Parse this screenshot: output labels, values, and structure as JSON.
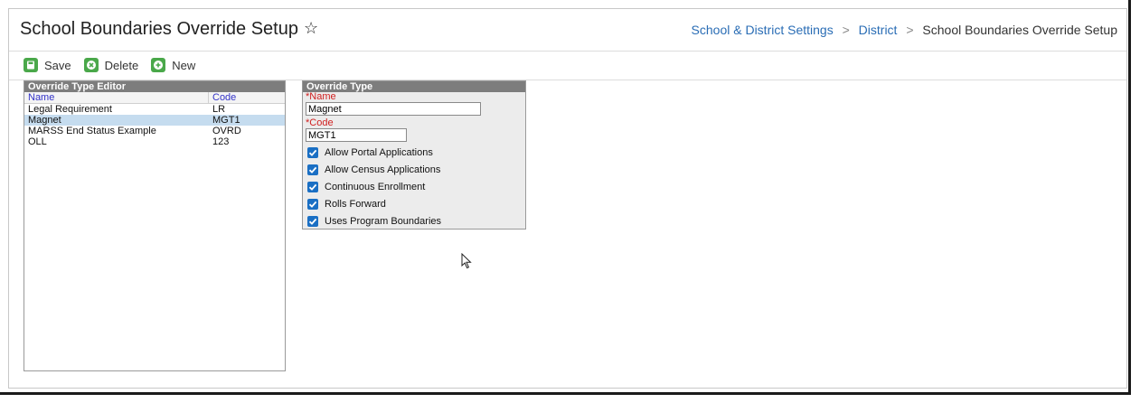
{
  "page": {
    "title": "School Boundaries Override Setup",
    "favorite_icon": "star-outline-icon"
  },
  "breadcrumb": {
    "items": [
      "School & District Settings",
      "District",
      "School Boundaries Override Setup"
    ],
    "separator": ">"
  },
  "toolbar": {
    "save_label": "Save",
    "delete_label": "Delete",
    "new_label": "New",
    "icon_color": "#4aa84a"
  },
  "editor": {
    "title": "Override Type Editor",
    "columns": [
      "Name",
      "Code"
    ],
    "rows": [
      {
        "name": "Legal Requirement",
        "code": "LR"
      },
      {
        "name": "Magnet",
        "code": "MGT1"
      },
      {
        "name": "MARSS End Status Example",
        "code": "OVRD"
      },
      {
        "name": "OLL",
        "code": "123"
      }
    ],
    "selected_index": 1
  },
  "override_type": {
    "title": "Override Type",
    "name_label": "*Name",
    "name_value": "Magnet",
    "code_label": "*Code",
    "code_value": "MGT1",
    "checkboxes": [
      {
        "label": "Allow Portal Applications",
        "checked": true
      },
      {
        "label": "Allow Census Applications",
        "checked": true
      },
      {
        "label": "Continuous Enrollment",
        "checked": true
      },
      {
        "label": "Rolls Forward",
        "checked": true
      },
      {
        "label": "Uses Program Boundaries",
        "checked": true
      }
    ]
  },
  "colors": {
    "link": "#2a6db5",
    "panel_header": "#7d7d7d",
    "selected_row": "#c5dcef",
    "required": "#d02020",
    "checkbox": "#1a6fc4"
  }
}
